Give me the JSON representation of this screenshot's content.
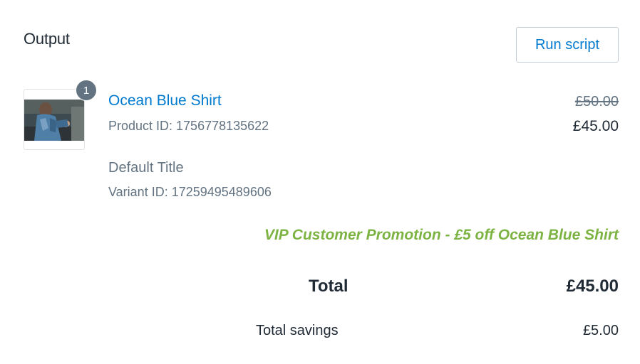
{
  "header": {
    "title": "Output",
    "run_button_label": "Run script"
  },
  "line_item": {
    "quantity": "1",
    "image_icon": "product-photo-shirt",
    "name": "Ocean Blue Shirt",
    "product_id_text": "Product ID: 1756778135622",
    "variant_title": "Default Title",
    "variant_id_text": "Variant ID: 17259495489606",
    "original_price": "£50.00",
    "discounted_price": "£45.00"
  },
  "promotion": {
    "message": "VIP Customer Promotion - £5 off Ocean Blue Shirt",
    "color": "#7cb342"
  },
  "summary": {
    "total_label": "Total",
    "total_value": "£45.00",
    "savings_label": "Total savings",
    "savings_value": "£5.00"
  },
  "colors": {
    "link": "#007ace",
    "muted": "#637381",
    "text": "#212b36"
  }
}
